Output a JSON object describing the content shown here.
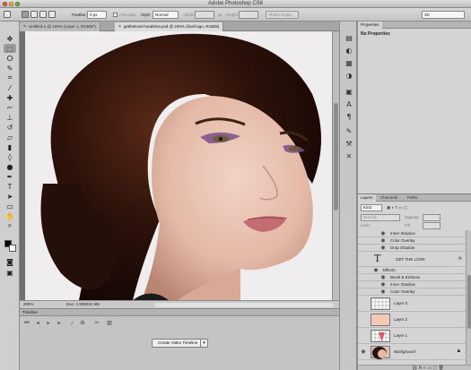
{
  "app": {
    "title": "Adobe Photoshop CS6"
  },
  "options_bar": {
    "feather_label": "Feather:",
    "feather_value": "0 px",
    "anti_alias_label": "Anti-alias",
    "style_label": "Style:",
    "style_value": "Normal",
    "width_label": "Width:",
    "height_label": "Height:",
    "refine_edge_label": "Refine Edge...",
    "workspace_value": "3D"
  },
  "document_tabs": [
    {
      "label": "Untitled-1 @ 100% (Layer 1, RGB/8*)"
    },
    {
      "label": "getthelook-headshot.psd @ 200% (final-logo, RGB/8)"
    }
  ],
  "status_bar": {
    "zoom": "200%",
    "doc_info": "Doc: 2.93M/22.9M"
  },
  "timeline": {
    "title": "Timeline",
    "create_button": "Create Video Timeline"
  },
  "properties_panel": {
    "tab": "Properties",
    "empty_message": "No Properties"
  },
  "layers_panel": {
    "tabs": [
      "Layers",
      "Channels",
      "Paths"
    ],
    "filter_value": "Kind",
    "blend_mode": "Normal",
    "opacity_label": "Opacity:",
    "lock_label": "Lock:",
    "fill_label": "Fill:",
    "rows": [
      {
        "name": "Inner Shadow",
        "kind": "effect"
      },
      {
        "name": "Color Overlay",
        "kind": "effect"
      },
      {
        "name": "Drop Shadow",
        "kind": "effect"
      },
      {
        "name": "GET THE LOOK",
        "kind": "text"
      },
      {
        "name": "Effects",
        "kind": "effects-header"
      },
      {
        "name": "Bevel & Emboss",
        "kind": "effect"
      },
      {
        "name": "Inner Shadow",
        "kind": "effect"
      },
      {
        "name": "Color Overlay",
        "kind": "effect"
      },
      {
        "name": "Layer 3",
        "kind": "layer"
      },
      {
        "name": "Layer 2",
        "kind": "layer"
      },
      {
        "name": "Layer 1",
        "kind": "layer"
      },
      {
        "name": "Background",
        "kind": "background"
      }
    ]
  },
  "colors": {
    "foreground": "#000000",
    "background": "#ffffff",
    "window_close": "#ef5b54",
    "window_minimize": "#f0b63b",
    "window_zoom": "#5dbb4a"
  }
}
